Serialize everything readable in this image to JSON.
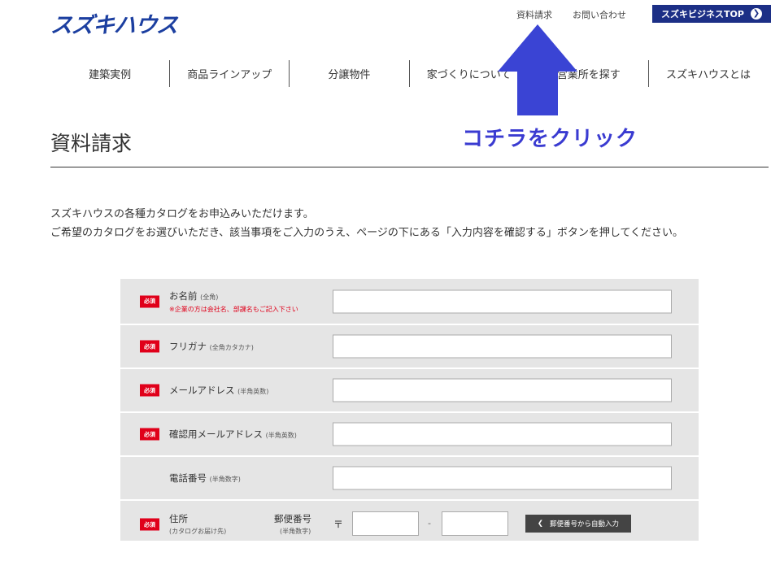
{
  "header": {
    "logo_text": "スズキハウス",
    "top_links": [
      "資料請求",
      "お問い合わせ"
    ],
    "business_top_label": "スズキビジネスTOP",
    "business_top_icon": "❯"
  },
  "gnav": [
    "建築実例",
    "商品ラインアップ",
    "分譲物件",
    "家づくりについて",
    "営業所を探す",
    "スズキハウスとは"
  ],
  "annotation": {
    "text": "コチラをクリック",
    "arrow_color": "#3a44d4"
  },
  "page": {
    "title": "資料請求",
    "intro_line1": "スズキハウスの各種カタログをお申込みいただけます。",
    "intro_line2": "ご希望のカタログをお選びいただき、該当事項をご入力のうえ、ページの下にある「入力内容を確認する」ボタンを押してください。"
  },
  "form": {
    "required_badge": "必須",
    "name": {
      "label": "お名前",
      "sub": "(全角)",
      "note": "※企業の方は会社名、部課名もご記入下さい"
    },
    "furigana": {
      "label": "フリガナ",
      "sub": "(全角カタカナ)"
    },
    "email": {
      "label": "メールアドレス",
      "sub": "(半角英数)"
    },
    "email_confirm": {
      "label": "確認用メールアドレス",
      "sub": "(半角英数)"
    },
    "phone": {
      "label": "電話番号",
      "sub": "(半角数字)"
    },
    "address": {
      "label": "住所",
      "sub": "(カタログお届け先)",
      "zip_label": "郵便番号",
      "zip_sub": "(半角数字)",
      "zip_mark": "〒",
      "zip_dash": "-",
      "auto_button": "郵便番号から自動入力",
      "auto_button_icon": "❮"
    }
  },
  "colors": {
    "brand": "#1c3fa0",
    "business_button": "#1c2f86",
    "required": "#e0001a",
    "row_bg": "#e5e5e5"
  }
}
